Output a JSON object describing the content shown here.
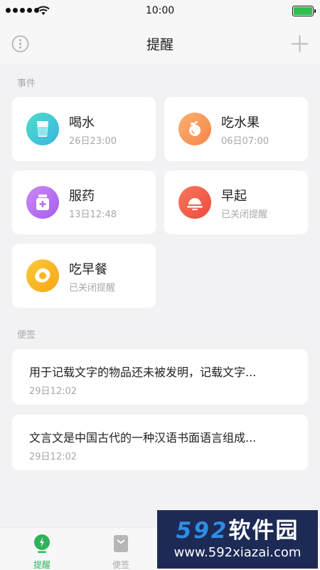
{
  "status_bar": {
    "time": "10:00",
    "battery_color": "#2fc04f"
  },
  "nav": {
    "title": "提醒",
    "left_icon": "info-icon",
    "right_icon": "plus-icon"
  },
  "sections": {
    "events_label": "事件",
    "notes_label": "便签"
  },
  "events": [
    {
      "title": "喝水",
      "subtitle": "26日23:00",
      "icon": "water-glass-icon",
      "color": "#3fc6d9"
    },
    {
      "title": "吃水果",
      "subtitle": "06日07:00",
      "icon": "fruit-icon",
      "color": "#f79a59"
    },
    {
      "title": "服药",
      "subtitle": "13日12:48",
      "icon": "medicine-bottle-icon",
      "color": "#b86cf0"
    },
    {
      "title": "早起",
      "subtitle": "已关闭提醒",
      "icon": "sunrise-icon",
      "color": "#f35b47"
    },
    {
      "title": "吃早餐",
      "subtitle": "已关闭提醒",
      "icon": "fried-egg-icon",
      "color": "#f9b21d"
    }
  ],
  "notes": [
    {
      "text": "用于记载文字的物品还未被发明，记载文字...",
      "time": "29日12:02"
    },
    {
      "text": "文言文是中国古代的一种汉语书面语言组成...",
      "time": "29日12:02"
    }
  ],
  "tabbar": {
    "tabs": [
      {
        "label": "提醒",
        "icon": "reminder-icon",
        "active": true,
        "color": "#2fb35a"
      },
      {
        "label": "便签",
        "icon": "notes-icon",
        "active": false,
        "color": "#aaaaaa"
      }
    ]
  },
  "watermark": {
    "line1_num": "592",
    "line1_text": "软件园",
    "line2": "www.592xiazai.com"
  }
}
